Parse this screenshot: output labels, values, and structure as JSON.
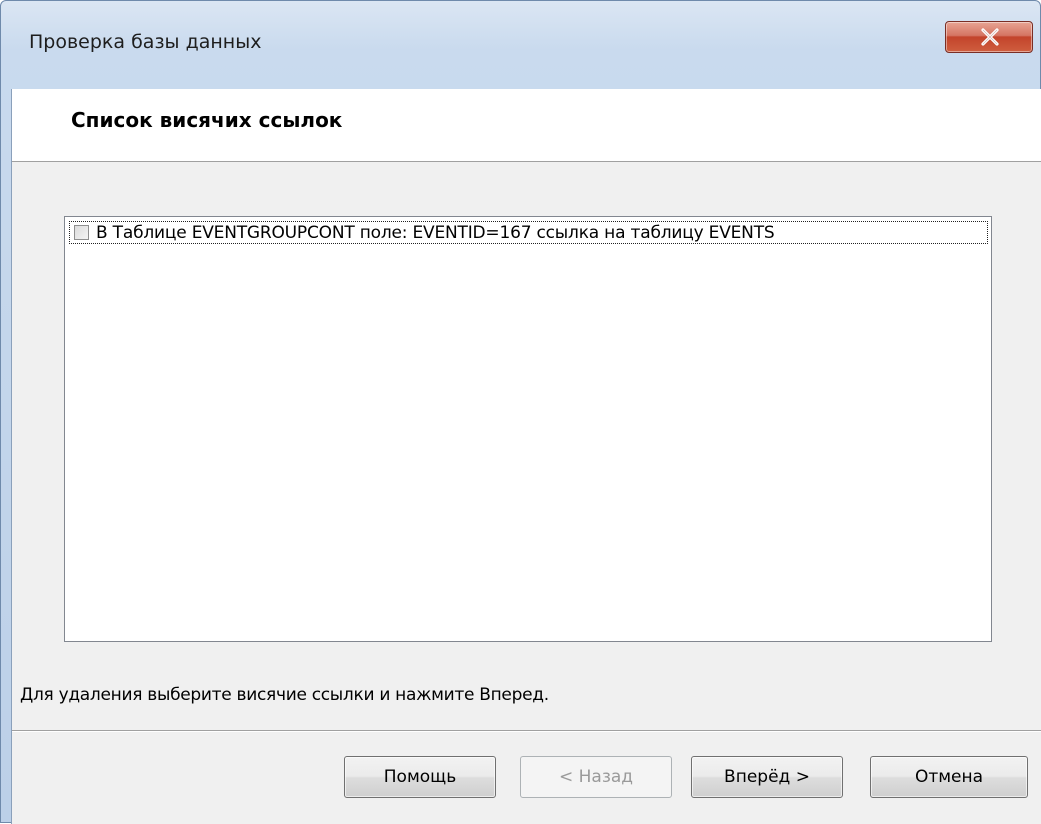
{
  "window": {
    "title": "Проверка базы данных"
  },
  "titlebar": {
    "close_icon": "close-x-icon"
  },
  "header": {
    "heading": "Список висячих ссылок"
  },
  "list": {
    "items": [
      {
        "checked": false,
        "label": "В Таблице EVENTGROUPCONT поле: EVENTID=167 ссылка на таблицу EVENTS"
      }
    ]
  },
  "instruction": "Для удаления выберите висячие ссылки и нажмите Вперед.",
  "buttons": {
    "help": "Помощь",
    "back": "< Назад",
    "next": "Вперёд >",
    "cancel": "Отмена"
  },
  "state": {
    "back_enabled": false
  },
  "colors": {
    "close_button": "#c3442b",
    "client_background": "#f0f0f0"
  }
}
